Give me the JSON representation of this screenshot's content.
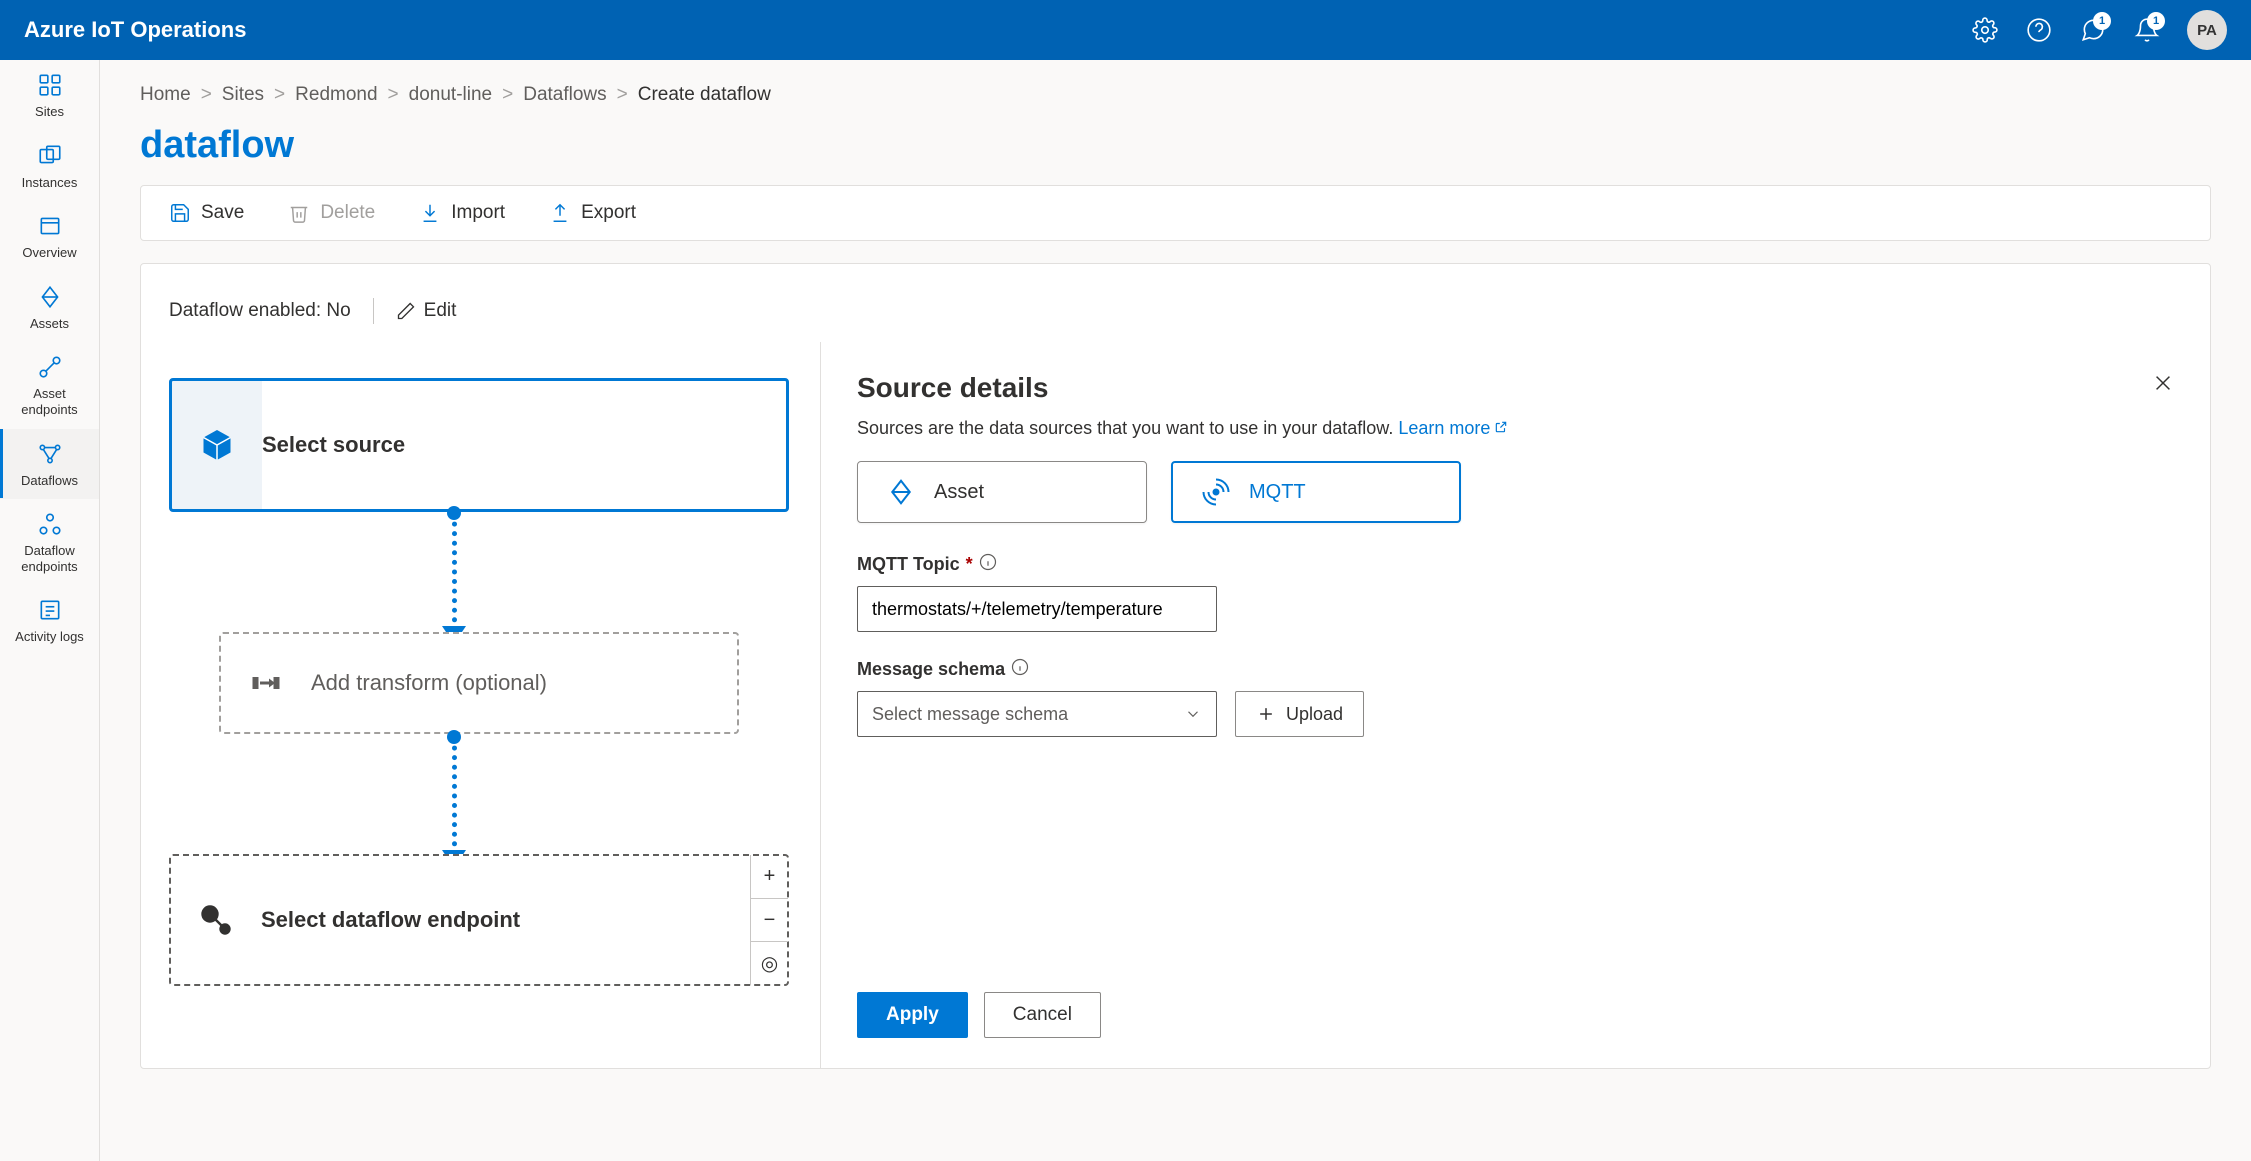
{
  "header": {
    "title": "Azure IoT Operations",
    "badge1": "1",
    "badge2": "1",
    "avatar": "PA"
  },
  "sidebar": {
    "items": [
      {
        "label": "Sites"
      },
      {
        "label": "Instances"
      },
      {
        "label": "Overview"
      },
      {
        "label": "Assets"
      },
      {
        "label": "Asset endpoints"
      },
      {
        "label": "Dataflows"
      },
      {
        "label": "Dataflow endpoints"
      },
      {
        "label": "Activity logs"
      }
    ]
  },
  "breadcrumb": {
    "items": [
      "Home",
      "Sites",
      "Redmond",
      "donut-line",
      "Dataflows",
      "Create dataflow"
    ]
  },
  "page": {
    "title": "dataflow"
  },
  "toolbar": {
    "save": "Save",
    "delete": "Delete",
    "import": "Import",
    "export": "Export"
  },
  "status": {
    "label": "Dataflow enabled: No",
    "edit": "Edit"
  },
  "canvas": {
    "source": "Select source",
    "transform": "Add transform (optional)",
    "dest": "Select dataflow endpoint",
    "plus": "+",
    "minus": "−",
    "target": "◎"
  },
  "details": {
    "title": "Source details",
    "desc": "Sources are the data sources that you want to use in your dataflow. ",
    "learn": "Learn more",
    "tabs": {
      "asset": "Asset",
      "mqtt": "MQTT"
    },
    "topic_label": "MQTT Topic",
    "topic_value": "thermostats/+/telemetry/temperature",
    "schema_label": "Message schema",
    "schema_placeholder": "Select message schema",
    "upload": "Upload",
    "apply": "Apply",
    "cancel": "Cancel"
  }
}
